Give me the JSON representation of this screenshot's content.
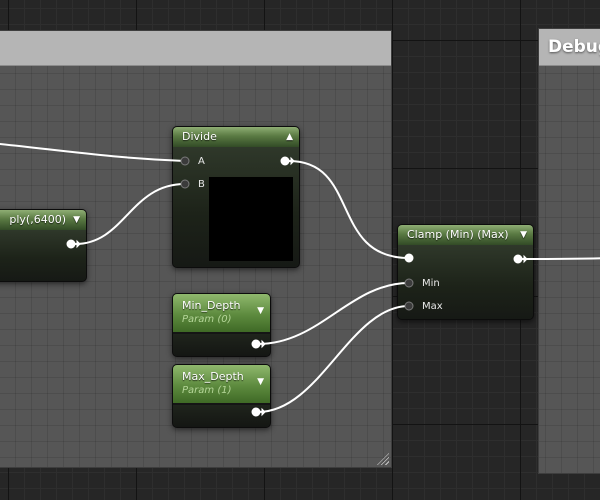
{
  "canvas": {
    "background": "#262626",
    "comment_header_color": "#b5b5b5",
    "comment_body_color": "#565656"
  },
  "debug_comment": {
    "title": "Debug"
  },
  "nodes": {
    "multiply": {
      "title": "ply(,6400)",
      "collapse_icon": "chevron-down-icon"
    },
    "divide": {
      "title": "Divide",
      "collapse_icon": "chevron-up-icon",
      "inputs": [
        "A",
        "B"
      ]
    },
    "clamp": {
      "title": "Clamp (Min) (Max)",
      "collapse_icon": "chevron-down-icon",
      "inputs": [
        "Min",
        "Max"
      ]
    },
    "min_depth": {
      "title": "Min_Depth",
      "subtitle": "Param (0)",
      "collapse_icon": "chevron-down-icon"
    },
    "max_depth": {
      "title": "Max_Depth",
      "subtitle": "Param (1)",
      "collapse_icon": "chevron-down-icon"
    }
  },
  "colors": {
    "node_header_green": "#5a7a43",
    "param_header_green": "#5d8a3e",
    "wire": "#ffffff"
  }
}
